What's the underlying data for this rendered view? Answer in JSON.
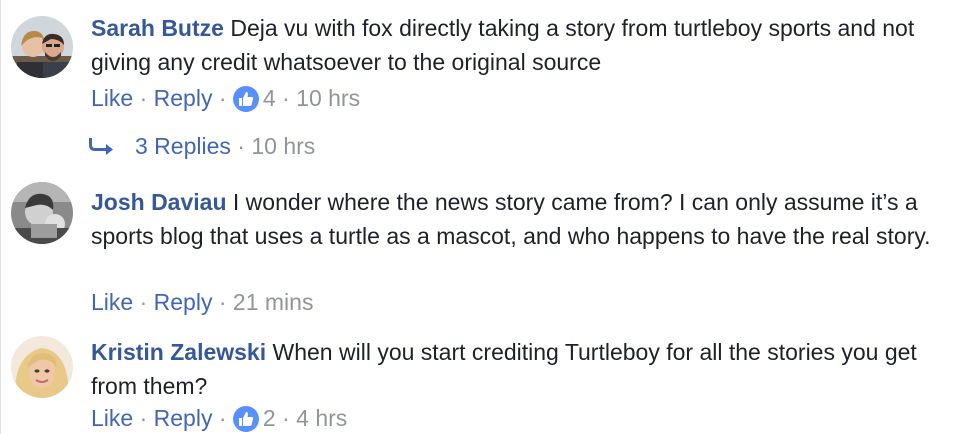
{
  "comments": [
    {
      "author": "Sarah Butze",
      "text": "Deja vu with fox directly taking a story from turtleboy sports and not giving any credit whatsoever to the original source",
      "like_label": "Like",
      "reply_label": "Reply",
      "reactions": "4",
      "time": "10 hrs",
      "replies_label": "3 Replies",
      "replies_time": "10 hrs"
    },
    {
      "author": "Josh Daviau",
      "text": "I wonder where the news story came from? I can only assume it’s a sports blog that uses a turtle as a mascot, and who happens to have the real story.",
      "like_label": "Like",
      "reply_label": "Reply",
      "time": "21 mins"
    },
    {
      "author": "Kristin Zalewski",
      "text": "When will you start crediting Turtleboy for all the stories you get from them?",
      "like_label": "Like",
      "reply_label": "Reply",
      "reactions": "2",
      "time": "4 hrs"
    }
  ],
  "separator": "·",
  "colors": {
    "author": "#365899",
    "link": "#4267b2",
    "meta": "#90949c",
    "text": "#1d2129",
    "like_badge": "#5890ff"
  },
  "icons": {
    "like": "thumbs-up-icon",
    "reply_arrow": "reply-arrow-icon"
  }
}
